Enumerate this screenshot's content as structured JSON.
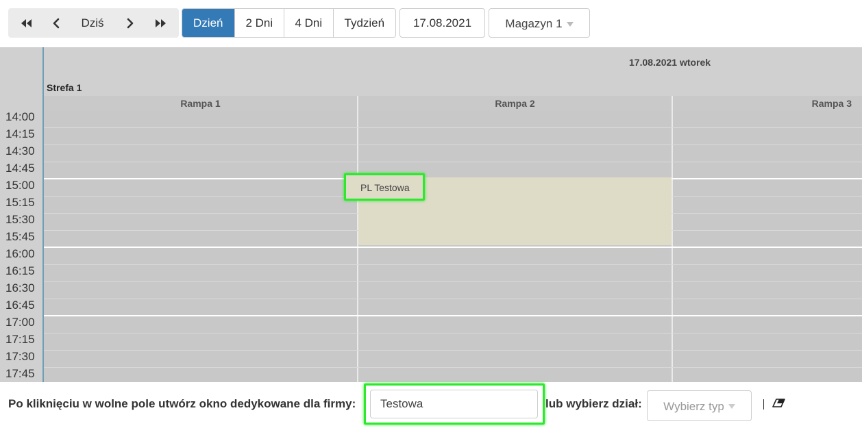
{
  "toolbar": {
    "nav": {
      "first_icon": "double-chevron-left-icon",
      "prev_icon": "chevron-left-icon",
      "today_label": "Dziś",
      "next_icon": "chevron-right-icon",
      "last_icon": "double-chevron-right-icon"
    },
    "views": [
      {
        "label": "Dzień",
        "active": true
      },
      {
        "label": "2 Dni",
        "active": false
      },
      {
        "label": "4 Dni",
        "active": false
      },
      {
        "label": "Tydzień",
        "active": false
      }
    ],
    "date": "17.08.2021",
    "warehouse": "Magazyn 1"
  },
  "calendar": {
    "date_header": "17.08.2021 wtorek",
    "zone": "Strefa 1",
    "ramps": [
      "Rampa 1",
      "Rampa 2",
      "Rampa 3"
    ],
    "times": [
      "14:00",
      "14:15",
      "14:30",
      "14:45",
      "15:00",
      "15:15",
      "15:30",
      "15:45",
      "16:00",
      "16:15",
      "16:30",
      "16:45",
      "17:00",
      "17:15",
      "17:30",
      "17:45"
    ],
    "event": {
      "label": "PL Testowa",
      "ramp": "Rampa 2",
      "start": "15:00",
      "end": "16:00",
      "color": "#dedbc7"
    }
  },
  "bottom": {
    "prompt_text": "Po kliknięciu w wolne pole utwórz okno dedykowane dla firmy:",
    "company_value": "Testowa",
    "or_text": "lub wybierz dział:",
    "type_placeholder": "Wybierz typ",
    "eraser_icon": "eraser-icon"
  },
  "colors": {
    "accent": "#337ab7",
    "highlight": "#2ee82e",
    "grid": "#c8c8c8"
  }
}
